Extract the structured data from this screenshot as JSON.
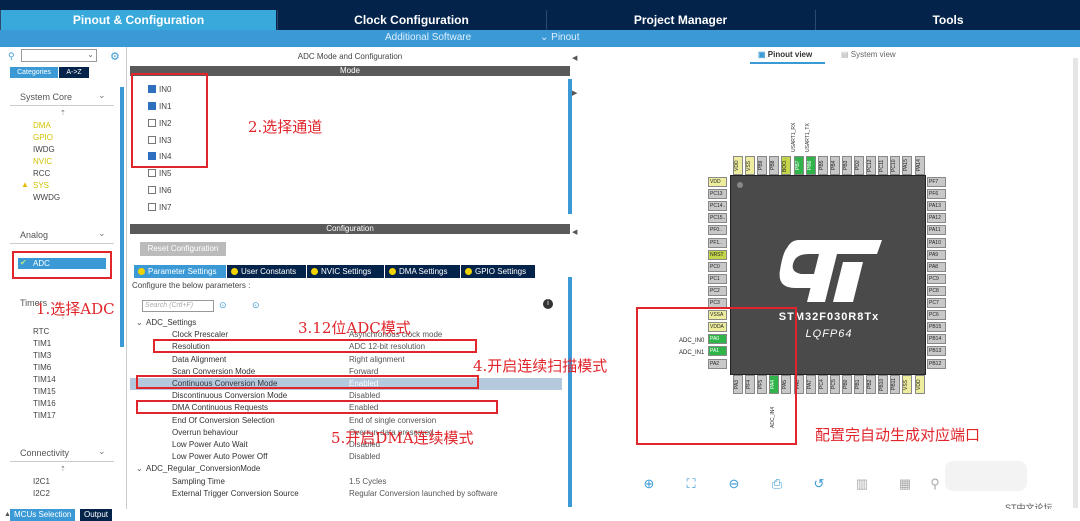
{
  "top_tabs": [
    "Pinout & Configuration",
    "Clock Configuration",
    "Project Manager",
    "Tools"
  ],
  "sub_bar": {
    "additional_software": "Additional Software",
    "pinout": "⌄ Pinout"
  },
  "left": {
    "tabs": [
      "Categories",
      "A->Z"
    ],
    "system_core": {
      "header": "System Core",
      "items": [
        "DMA",
        "GPIO",
        "IWDG",
        "NVIC",
        "RCC",
        "SYS",
        "WWDG"
      ]
    },
    "analog": {
      "header": "Analog",
      "items": [
        "ADC"
      ]
    },
    "timers": {
      "header": "Timers",
      "items": [
        "RTC",
        "TIM1",
        "TIM3",
        "TIM6",
        "TIM14",
        "TIM15",
        "TIM16",
        "TIM17"
      ]
    },
    "connectivity": {
      "header": "Connectivity",
      "items": [
        "I2C1",
        "I2C2"
      ]
    }
  },
  "mid": {
    "title": "ADC Mode and Configuration",
    "mode_header": "Mode",
    "channels": [
      {
        "label": "IN0",
        "checked": true
      },
      {
        "label": "IN1",
        "checked": true
      },
      {
        "label": "IN2",
        "checked": false
      },
      {
        "label": "IN3",
        "checked": false
      },
      {
        "label": "IN4",
        "checked": true
      },
      {
        "label": "IN5",
        "checked": false
      },
      {
        "label": "IN6",
        "checked": false
      },
      {
        "label": "IN7",
        "checked": false
      }
    ],
    "config_header": "Configuration",
    "reset_button": "Reset Configuration",
    "sub_tabs": [
      "Parameter Settings",
      "User Constants",
      "NVIC Settings",
      "DMA Settings",
      "GPIO Settings"
    ],
    "configure_text": "Configure the below parameters :",
    "search_placeholder": "Search (Crtl+F)",
    "params": [
      {
        "section": "ADC_Settings"
      },
      {
        "name": "Clock Prescaler",
        "value": "Asynchronous clock mode"
      },
      {
        "name": "Resolution",
        "value": "ADC 12-bit resolution"
      },
      {
        "name": "Data Alignment",
        "value": "Right alignment"
      },
      {
        "name": "Scan Conversion Mode",
        "value": "Forward"
      },
      {
        "name": "Continuous Conversion Mode",
        "value": "Enabled",
        "selected": true
      },
      {
        "name": "Discontinuous Conversion Mode",
        "value": "Disabled"
      },
      {
        "name": "DMA Continuous Requests",
        "value": "Enabled"
      },
      {
        "name": "End Of Conversion Selection",
        "value": "End of single conversion"
      },
      {
        "name": "Overrun behaviour",
        "value": "Overrun data preserved"
      },
      {
        "name": "Low Power Auto Wait",
        "value": "Disabled"
      },
      {
        "name": "Low Power Auto Power Off",
        "value": "Disabled"
      },
      {
        "section": "ADC_Regular_ConversionMode"
      },
      {
        "name": "Sampling Time",
        "value": "1.5 Cycles"
      },
      {
        "name": "External Trigger Conversion Source",
        "value": "Regular Conversion launched by software"
      }
    ]
  },
  "right": {
    "views": [
      "Pinout view",
      "System view"
    ],
    "chip_name": "STM32F030R8Tx",
    "package": "LQFP64",
    "usart_labels": [
      "USART1_RX",
      "USART1_TX"
    ],
    "adc_labels": [
      "ADC_IN0",
      "ADC_IN1"
    ],
    "adc_in4": "ADC_IN4",
    "top_pins": [
      "VDD",
      "VSS",
      "PB9",
      "PB8",
      "BOO..",
      "PB7",
      "PB6",
      "PB5",
      "PB4",
      "PB3",
      "PD2",
      "PC12",
      "PC11",
      "PC10",
      "PA15",
      "PA14"
    ],
    "bottom_pins": [
      "PA3",
      "PF4",
      "PF5",
      "PA4",
      "PA5",
      "PA6",
      "PA7",
      "PC4",
      "PC5",
      "PB0",
      "PB1",
      "PB2",
      "PB10",
      "PB11",
      "VSS",
      "VDD"
    ],
    "left_pins": [
      "VDD",
      "PC13",
      "PC14..",
      "PC15..",
      "PF0..",
      "PF1..",
      "NRST",
      "PC0",
      "PC1",
      "PC2",
      "PC3",
      "VSSA",
      "VDDA",
      "PA0",
      "PA1",
      "PA2"
    ],
    "right_pins": [
      "PF7",
      "PF6",
      "PA13",
      "PA12",
      "PA11",
      "PA10",
      "PA9",
      "PA8",
      "PC9",
      "PC8",
      "PC7",
      "PC6",
      "PB15",
      "PB14",
      "PB13",
      "PB12"
    ]
  },
  "annotations": {
    "a1": "1.选择ADC",
    "a2": "2.选择通道",
    "a3": "3.12位ADC模式",
    "a4": "4.开启连续扫描模式",
    "a5": "5.开启DMA连续模式",
    "a6": "配置完自动生成对应端口"
  },
  "watermark": {
    "forum": "ST中文论坛"
  },
  "bottom_tabs": [
    "MCUs Selection",
    "Output"
  ],
  "colors": {
    "navy": "#03234b",
    "blue": "#3b9ad6",
    "red": "#e0252b",
    "green": "#2fb44a"
  }
}
